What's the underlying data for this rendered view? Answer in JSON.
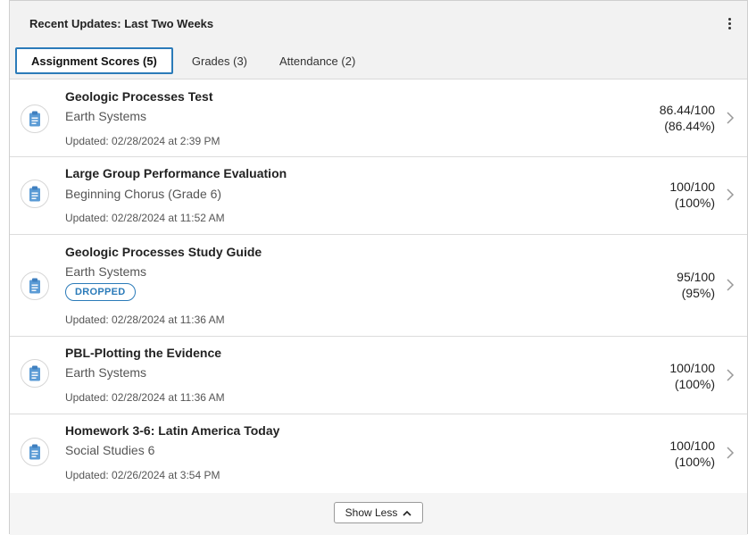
{
  "header": {
    "title": "Recent Updates: Last Two Weeks",
    "menu_icon": "kebab-icon"
  },
  "tabs": [
    {
      "label": "Assignment Scores (5)",
      "active": true
    },
    {
      "label": "Grades (3)",
      "active": false
    },
    {
      "label": "Attendance (2)",
      "active": false
    }
  ],
  "items": [
    {
      "title": "Geologic Processes Test",
      "course": "Earth Systems",
      "updated": "Updated: 02/28/2024 at 2:39 PM",
      "score": "86.44/100",
      "percent": "(86.44%)",
      "icon": "clipboard-icon"
    },
    {
      "title": "Large Group Performance Evaluation",
      "course": "Beginning Chorus (Grade 6)",
      "updated": "Updated: 02/28/2024 at 11:52 AM",
      "score": "100/100",
      "percent": "(100%)",
      "icon": "clipboard-icon"
    },
    {
      "title": "Geologic Processes Study Guide",
      "course": "Earth Systems",
      "badge": "DROPPED",
      "updated": "Updated: 02/28/2024 at 11:36 AM",
      "score": "95/100",
      "percent": "(95%)",
      "icon": "clipboard-icon"
    },
    {
      "title": "PBL-Plotting the Evidence",
      "course": "Earth Systems",
      "updated": "Updated: 02/28/2024 at 11:36 AM",
      "score": "100/100",
      "percent": "(100%)",
      "icon": "clipboard-icon"
    },
    {
      "title": "Homework 3-6: Latin America Today",
      "course": "Social Studies 6",
      "updated": "Updated: 02/26/2024 at 3:54 PM",
      "score": "100/100",
      "percent": "(100%)",
      "icon": "clipboard-icon"
    }
  ],
  "footer": {
    "show_less_label": "Show Less"
  },
  "colors": {
    "accent": "#2b7bb9",
    "icon_blue": "#5b9bd5"
  }
}
